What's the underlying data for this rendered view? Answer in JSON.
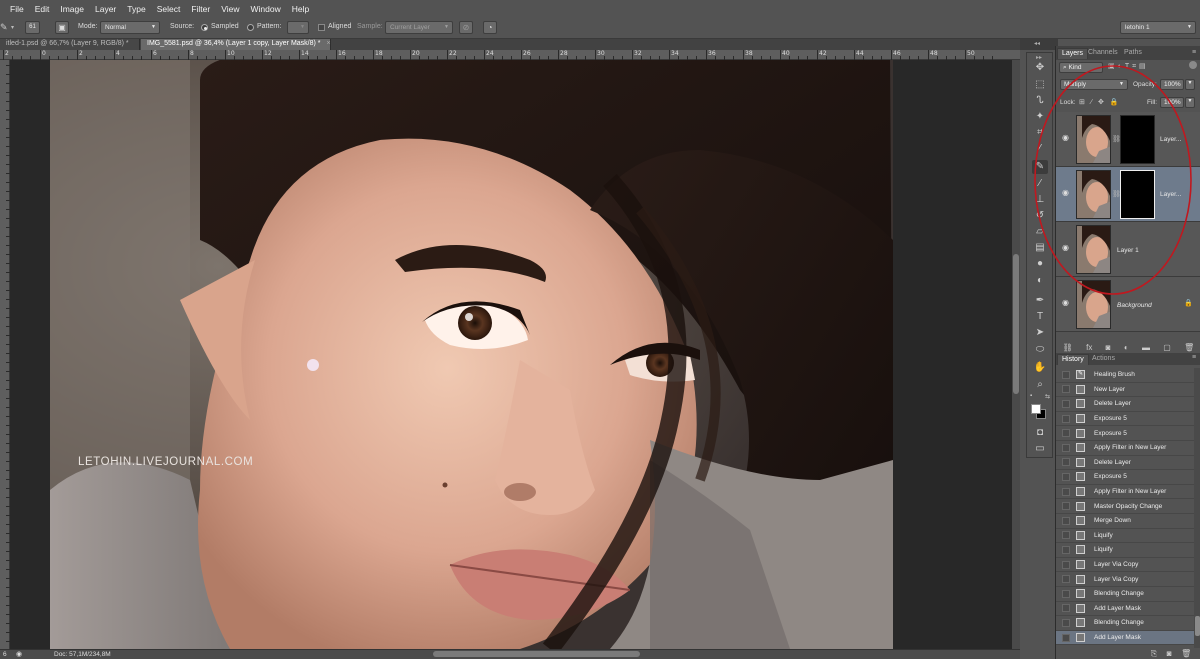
{
  "menu": {
    "items": [
      "File",
      "Edit",
      "Image",
      "Layer",
      "Type",
      "Select",
      "Filter",
      "View",
      "Window",
      "Help"
    ]
  },
  "options": {
    "brush_size": "61",
    "mode_label": "Mode:",
    "mode_value": "Normal",
    "source_label": "Source:",
    "source_sampled": "Sampled",
    "source_pattern": "Pattern:",
    "aligned_label": "Aligned",
    "sample_label": "Sample:",
    "sample_value": "Current Layer",
    "workspace": "letohin 1"
  },
  "tabs": [
    {
      "label": "itled-1.psd @ 66,7% (Layer 9, RGB/8) *",
      "active": false
    },
    {
      "label": "IMG_5581.psd @ 36,4% (Layer 1 copy, Layer Mask/8) *",
      "active": true
    }
  ],
  "ruler": {
    "numbers": [
      "2",
      "0",
      "2",
      "4",
      "6",
      "8",
      "10",
      "12",
      "14",
      "16",
      "18",
      "20",
      "22",
      "24",
      "26",
      "28",
      "30",
      "32",
      "34",
      "36",
      "38",
      "40",
      "42",
      "44",
      "46",
      "48",
      "50"
    ]
  },
  "canvas": {
    "watermark": "LETOHIN.LIVEJOURNAL.COM"
  },
  "status": {
    "zoom": "6",
    "doc_info": "Doc: 57,1M/234,8M"
  },
  "layers_panel": {
    "tabs": [
      "Layers",
      "Channels",
      "Paths"
    ],
    "filter_kind": "Kind",
    "blend_mode": "Multiply",
    "opacity_label": "Opacity:",
    "opacity_value": "100%",
    "lock_label": "Lock:",
    "fill_label": "Fill:",
    "fill_value": "100%",
    "layers": [
      {
        "name": "Layer...",
        "has_mask": true,
        "selected": false
      },
      {
        "name": "Layer...",
        "has_mask": true,
        "selected": true
      },
      {
        "name": "Layer 1",
        "has_mask": false,
        "selected": false
      },
      {
        "name": "Background",
        "has_mask": false,
        "selected": false,
        "locked": true
      }
    ]
  },
  "history_panel": {
    "tabs": [
      "History",
      "Actions"
    ],
    "items": [
      "Healing Brush",
      "New Layer",
      "Delete Layer",
      "Exposure 5",
      "Exposure 5",
      "Apply Filter in New Layer",
      "Delete Layer",
      "Exposure 5",
      "Apply Filter in New Layer",
      "Master Opacity Change",
      "Merge Down",
      "Liquify",
      "Liquify",
      "Layer Via Copy",
      "Layer Via Copy",
      "Blending Change",
      "Add Layer Mask",
      "Blending Change",
      "Add Layer Mask"
    ],
    "selected_index": 18
  },
  "icons": {
    "annotation_color": "#c0181f"
  }
}
